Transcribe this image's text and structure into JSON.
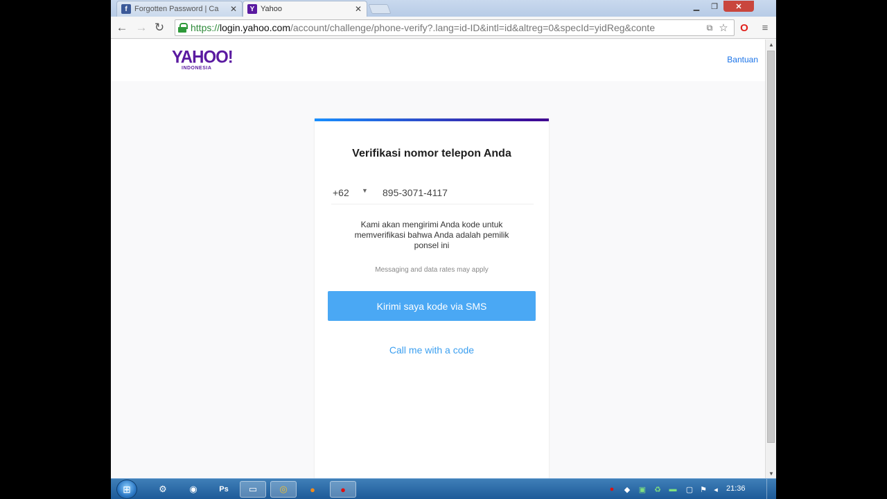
{
  "browser": {
    "tabs": [
      {
        "title": "Forgotten Password | Ca",
        "favicon": "facebook-icon",
        "active": false
      },
      {
        "title": "Yahoo",
        "favicon": "yahoo-icon",
        "active": true
      }
    ],
    "url": {
      "scheme": "https://",
      "host": "login.yahoo.com",
      "rest": "/account/challenge/phone-verify?.lang=id-ID&intl=id&altreg=0&specId=yidReg&conte"
    }
  },
  "page": {
    "logo_text": "YAHOO!",
    "logo_sub": "INDONESIA",
    "help_link": "Bantuan"
  },
  "card": {
    "title": "Verifikasi nomor telepon Anda",
    "country_code": "+62",
    "phone_number": "895-3071-4117",
    "description": "Kami akan mengirimi Anda kode untuk memverifikasi bahwa Anda adalah pemilik ponsel ini",
    "disclaimer": "Messaging and data rates may apply",
    "sms_button": "Kirimi saya kode via SMS",
    "call_link": "Call me with a code"
  },
  "taskbar": {
    "clock": "21:36"
  },
  "colors": {
    "yahoo_purple": "#5a1aa0",
    "button_blue": "#4aa8f4",
    "link_blue": "#3b9ff0"
  }
}
